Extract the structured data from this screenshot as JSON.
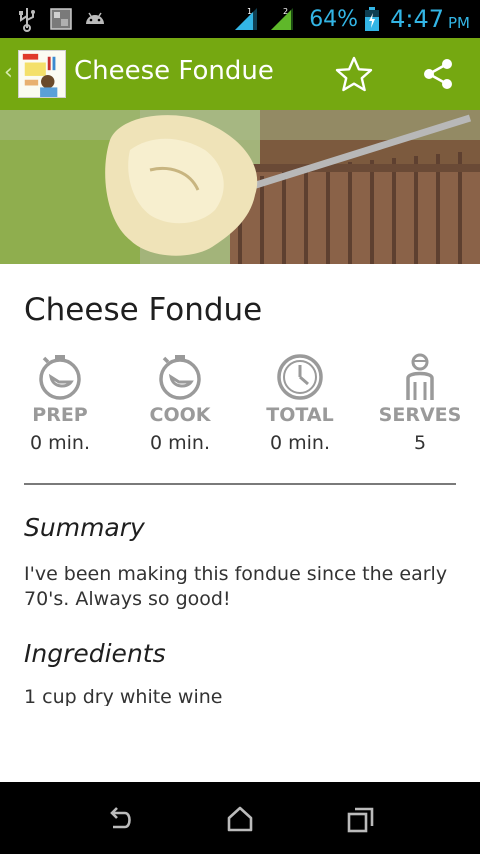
{
  "status_bar": {
    "battery_percent": "64%",
    "time": "4:47",
    "ampm": "PM",
    "signal_1_label": "1",
    "signal_2_label": "2",
    "icons": [
      "usb-icon",
      "gallery-icon",
      "android-icon",
      "signal-icon",
      "signal-icon",
      "battery-icon"
    ],
    "accent_color": "#33b5e5"
  },
  "action_bar": {
    "title": "Cheese Fondue",
    "background_color": "#75a811",
    "icons": [
      "app-logo-icon",
      "star-icon",
      "share-icon"
    ]
  },
  "recipe": {
    "title": "Cheese Fondue",
    "stats": [
      {
        "label": "PREP",
        "value": "0 min.",
        "icon": "timer-icon"
      },
      {
        "label": "COOK",
        "value": "0 min.",
        "icon": "timer-icon"
      },
      {
        "label": "TOTAL",
        "value": "0 min.",
        "icon": "clock-icon"
      },
      {
        "label": "SERVES",
        "value": "5",
        "icon": "person-icon"
      }
    ],
    "summary_heading": "Summary",
    "summary": "I've been making this fondue since the early 70's. Always so good!",
    "ingredients_heading": "Ingredients",
    "ingredients": [
      "1 cup dry white wine"
    ]
  },
  "nav_bar": {
    "icons": [
      "back-icon",
      "home-icon",
      "recents-icon"
    ]
  }
}
